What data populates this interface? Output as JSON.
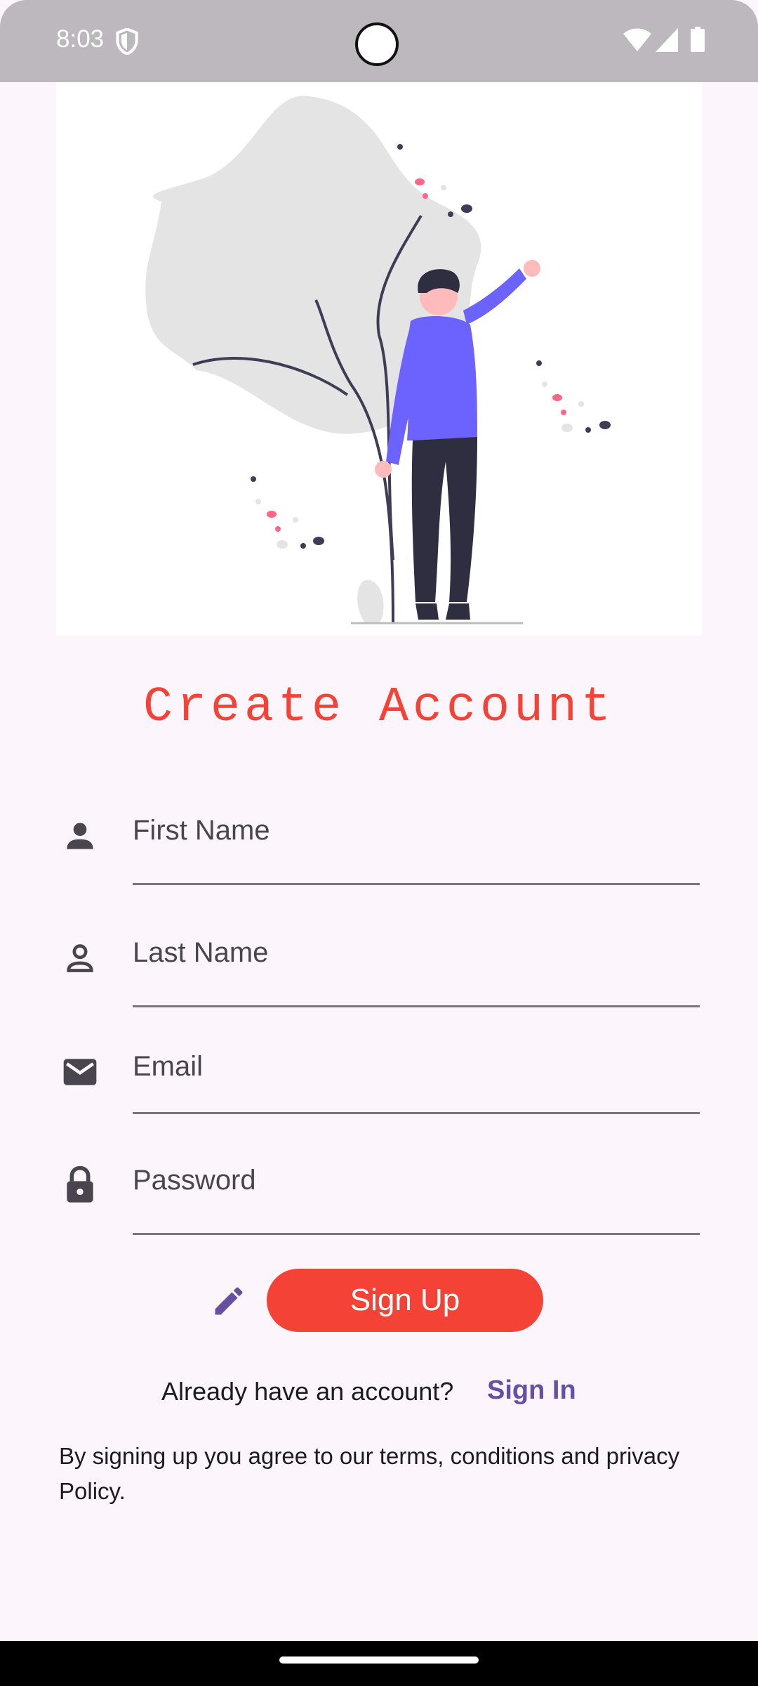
{
  "status_bar": {
    "time": "8:03"
  },
  "title": "Create Account",
  "form": {
    "first_name_label": "First Name",
    "last_name_label": "Last Name",
    "email_label": "Email",
    "password_label": "Password"
  },
  "actions": {
    "signup_label": "Sign Up"
  },
  "signin_prompt": {
    "text": "Already have an account?",
    "link": "Sign In"
  },
  "terms": "By signing up you agree to our terms, conditions and privacy Policy.",
  "colors": {
    "accent": "#f44336",
    "link": "#6750a4",
    "background": "#fcf5fc",
    "illustration_purple": "#6c63ff"
  },
  "icons": [
    "shield-icon",
    "wifi-icon",
    "signal-icon",
    "battery-icon",
    "person-icon",
    "person-outline-icon",
    "mail-icon",
    "lock-icon",
    "pencil-icon"
  ]
}
